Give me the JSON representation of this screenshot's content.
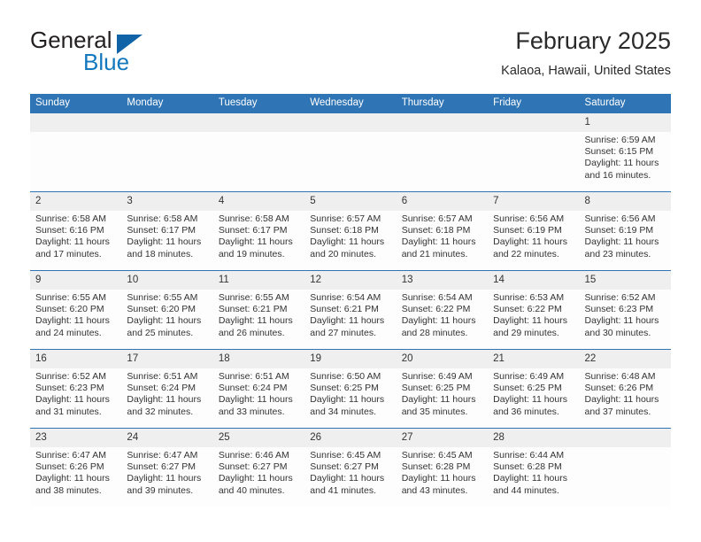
{
  "brand": {
    "name_part1": "General",
    "name_part2": "Blue",
    "triangle_color": "#1163a8",
    "blue_text_color": "#1478be"
  },
  "header": {
    "title": "February 2025",
    "location": "Kalaoa, Hawaii, United States"
  },
  "theme": {
    "header_blue": "#2f74b5",
    "daynum_band": "#efefef",
    "cell_background": "#fdfdfd",
    "text": "#333333"
  },
  "weekdays": [
    "Sunday",
    "Monday",
    "Tuesday",
    "Wednesday",
    "Thursday",
    "Friday",
    "Saturday"
  ],
  "weeks": [
    [
      {
        "day": "",
        "sunrise": "",
        "sunset": "",
        "daylight": ""
      },
      {
        "day": "",
        "sunrise": "",
        "sunset": "",
        "daylight": ""
      },
      {
        "day": "",
        "sunrise": "",
        "sunset": "",
        "daylight": ""
      },
      {
        "day": "",
        "sunrise": "",
        "sunset": "",
        "daylight": ""
      },
      {
        "day": "",
        "sunrise": "",
        "sunset": "",
        "daylight": ""
      },
      {
        "day": "",
        "sunrise": "",
        "sunset": "",
        "daylight": ""
      },
      {
        "day": "1",
        "sunrise": "Sunrise: 6:59 AM",
        "sunset": "Sunset: 6:15 PM",
        "daylight": "Daylight: 11 hours and 16 minutes."
      }
    ],
    [
      {
        "day": "2",
        "sunrise": "Sunrise: 6:58 AM",
        "sunset": "Sunset: 6:16 PM",
        "daylight": "Daylight: 11 hours and 17 minutes."
      },
      {
        "day": "3",
        "sunrise": "Sunrise: 6:58 AM",
        "sunset": "Sunset: 6:17 PM",
        "daylight": "Daylight: 11 hours and 18 minutes."
      },
      {
        "day": "4",
        "sunrise": "Sunrise: 6:58 AM",
        "sunset": "Sunset: 6:17 PM",
        "daylight": "Daylight: 11 hours and 19 minutes."
      },
      {
        "day": "5",
        "sunrise": "Sunrise: 6:57 AM",
        "sunset": "Sunset: 6:18 PM",
        "daylight": "Daylight: 11 hours and 20 minutes."
      },
      {
        "day": "6",
        "sunrise": "Sunrise: 6:57 AM",
        "sunset": "Sunset: 6:18 PM",
        "daylight": "Daylight: 11 hours and 21 minutes."
      },
      {
        "day": "7",
        "sunrise": "Sunrise: 6:56 AM",
        "sunset": "Sunset: 6:19 PM",
        "daylight": "Daylight: 11 hours and 22 minutes."
      },
      {
        "day": "8",
        "sunrise": "Sunrise: 6:56 AM",
        "sunset": "Sunset: 6:19 PM",
        "daylight": "Daylight: 11 hours and 23 minutes."
      }
    ],
    [
      {
        "day": "9",
        "sunrise": "Sunrise: 6:55 AM",
        "sunset": "Sunset: 6:20 PM",
        "daylight": "Daylight: 11 hours and 24 minutes."
      },
      {
        "day": "10",
        "sunrise": "Sunrise: 6:55 AM",
        "sunset": "Sunset: 6:20 PM",
        "daylight": "Daylight: 11 hours and 25 minutes."
      },
      {
        "day": "11",
        "sunrise": "Sunrise: 6:55 AM",
        "sunset": "Sunset: 6:21 PM",
        "daylight": "Daylight: 11 hours and 26 minutes."
      },
      {
        "day": "12",
        "sunrise": "Sunrise: 6:54 AM",
        "sunset": "Sunset: 6:21 PM",
        "daylight": "Daylight: 11 hours and 27 minutes."
      },
      {
        "day": "13",
        "sunrise": "Sunrise: 6:54 AM",
        "sunset": "Sunset: 6:22 PM",
        "daylight": "Daylight: 11 hours and 28 minutes."
      },
      {
        "day": "14",
        "sunrise": "Sunrise: 6:53 AM",
        "sunset": "Sunset: 6:22 PM",
        "daylight": "Daylight: 11 hours and 29 minutes."
      },
      {
        "day": "15",
        "sunrise": "Sunrise: 6:52 AM",
        "sunset": "Sunset: 6:23 PM",
        "daylight": "Daylight: 11 hours and 30 minutes."
      }
    ],
    [
      {
        "day": "16",
        "sunrise": "Sunrise: 6:52 AM",
        "sunset": "Sunset: 6:23 PM",
        "daylight": "Daylight: 11 hours and 31 minutes."
      },
      {
        "day": "17",
        "sunrise": "Sunrise: 6:51 AM",
        "sunset": "Sunset: 6:24 PM",
        "daylight": "Daylight: 11 hours and 32 minutes."
      },
      {
        "day": "18",
        "sunrise": "Sunrise: 6:51 AM",
        "sunset": "Sunset: 6:24 PM",
        "daylight": "Daylight: 11 hours and 33 minutes."
      },
      {
        "day": "19",
        "sunrise": "Sunrise: 6:50 AM",
        "sunset": "Sunset: 6:25 PM",
        "daylight": "Daylight: 11 hours and 34 minutes."
      },
      {
        "day": "20",
        "sunrise": "Sunrise: 6:49 AM",
        "sunset": "Sunset: 6:25 PM",
        "daylight": "Daylight: 11 hours and 35 minutes."
      },
      {
        "day": "21",
        "sunrise": "Sunrise: 6:49 AM",
        "sunset": "Sunset: 6:25 PM",
        "daylight": "Daylight: 11 hours and 36 minutes."
      },
      {
        "day": "22",
        "sunrise": "Sunrise: 6:48 AM",
        "sunset": "Sunset: 6:26 PM",
        "daylight": "Daylight: 11 hours and 37 minutes."
      }
    ],
    [
      {
        "day": "23",
        "sunrise": "Sunrise: 6:47 AM",
        "sunset": "Sunset: 6:26 PM",
        "daylight": "Daylight: 11 hours and 38 minutes."
      },
      {
        "day": "24",
        "sunrise": "Sunrise: 6:47 AM",
        "sunset": "Sunset: 6:27 PM",
        "daylight": "Daylight: 11 hours and 39 minutes."
      },
      {
        "day": "25",
        "sunrise": "Sunrise: 6:46 AM",
        "sunset": "Sunset: 6:27 PM",
        "daylight": "Daylight: 11 hours and 40 minutes."
      },
      {
        "day": "26",
        "sunrise": "Sunrise: 6:45 AM",
        "sunset": "Sunset: 6:27 PM",
        "daylight": "Daylight: 11 hours and 41 minutes."
      },
      {
        "day": "27",
        "sunrise": "Sunrise: 6:45 AM",
        "sunset": "Sunset: 6:28 PM",
        "daylight": "Daylight: 11 hours and 43 minutes."
      },
      {
        "day": "28",
        "sunrise": "Sunrise: 6:44 AM",
        "sunset": "Sunset: 6:28 PM",
        "daylight": "Daylight: 11 hours and 44 minutes."
      },
      {
        "day": "",
        "sunrise": "",
        "sunset": "",
        "daylight": ""
      }
    ]
  ]
}
